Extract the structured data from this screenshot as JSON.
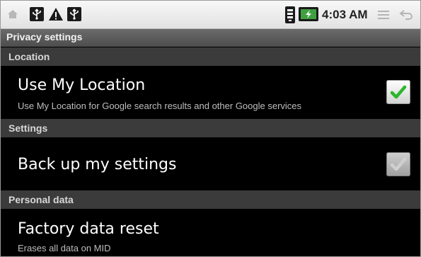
{
  "status_bar": {
    "time": "4:03 AM",
    "icons": [
      "home-icon",
      "usb-icon",
      "warning-icon",
      "usb-icon",
      "wifi-icon",
      "battery-charging-icon",
      "menu-icon",
      "back-icon"
    ]
  },
  "title_bar": {
    "title": "Privacy settings"
  },
  "sections": [
    {
      "header": "Location",
      "items": [
        {
          "title": "Use My Location",
          "summary": "Use My Location for Google search results and other Google services",
          "checked": true,
          "enabled": true
        }
      ]
    },
    {
      "header": "Settings",
      "items": [
        {
          "title": "Back up my settings",
          "summary": "",
          "checked": true,
          "enabled": false
        }
      ]
    },
    {
      "header": "Personal data",
      "items": [
        {
          "title": "Factory data reset",
          "summary": "Erases all data on MID"
        }
      ]
    }
  ],
  "colors": {
    "check_green": "#2db52d",
    "check_disabled": "#cfcfcf",
    "section_header_bg": "#3b3b3b",
    "title_bar_bg": "#5a5a5a",
    "status_bar_bg": "#ececec"
  }
}
